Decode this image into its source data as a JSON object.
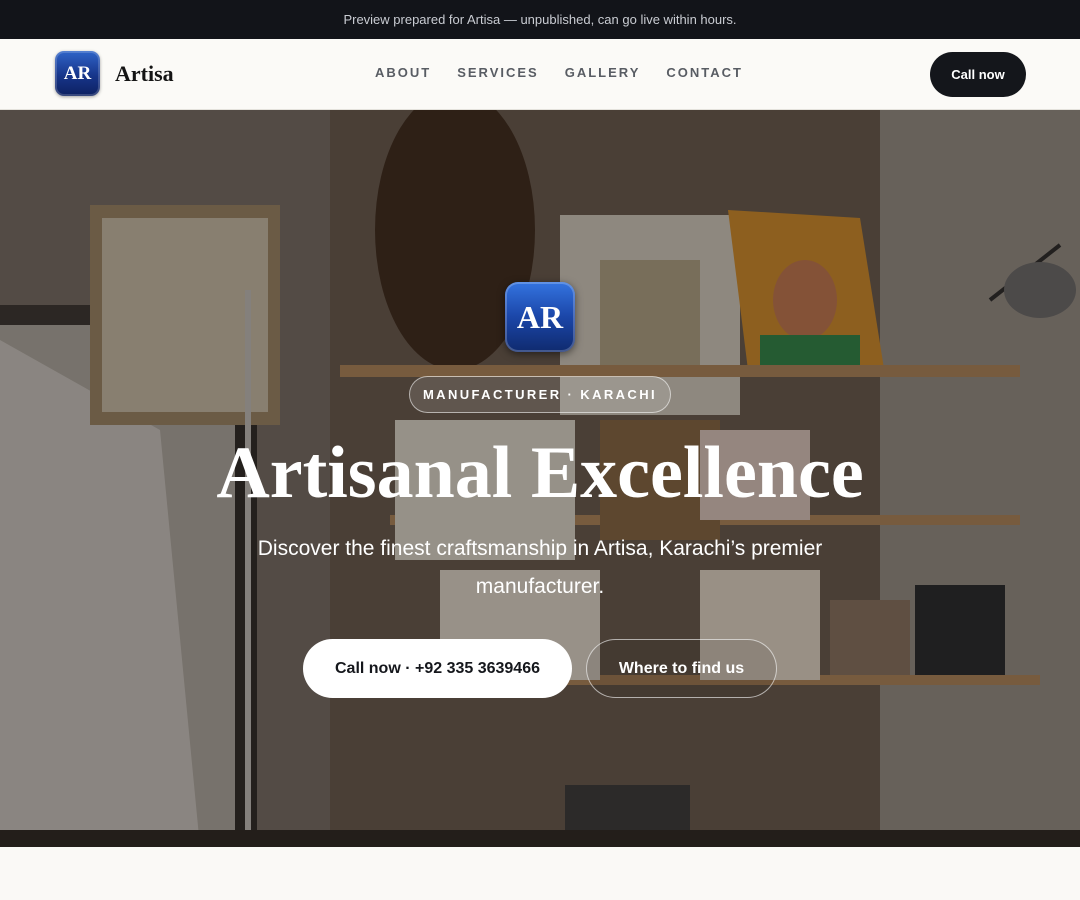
{
  "banner": {
    "text": "Preview prepared for Artisa — unpublished, can go live within hours."
  },
  "nav": {
    "logo_text": "AR",
    "brand": "Artisa",
    "items": [
      {
        "label": "ABOUT"
      },
      {
        "label": "SERVICES"
      },
      {
        "label": "GALLERY"
      },
      {
        "label": "CONTACT"
      }
    ],
    "cta": "Call now"
  },
  "hero": {
    "logo_text": "AR",
    "tag": "MANUFACTURER · KARACHI",
    "title": "Artisanal Excellence",
    "subtitle": "Discover the finest craftsmanship in Artisa, Karachi’s premier manufacturer.",
    "primary_cta": "Call now · +92 335 3639466",
    "secondary_cta": "Where to find us"
  },
  "colors": {
    "topbar": "#121419",
    "nav_cta": "#14161b",
    "logo_blue": "#1b46a8",
    "page_bg": "#faf9f6"
  }
}
